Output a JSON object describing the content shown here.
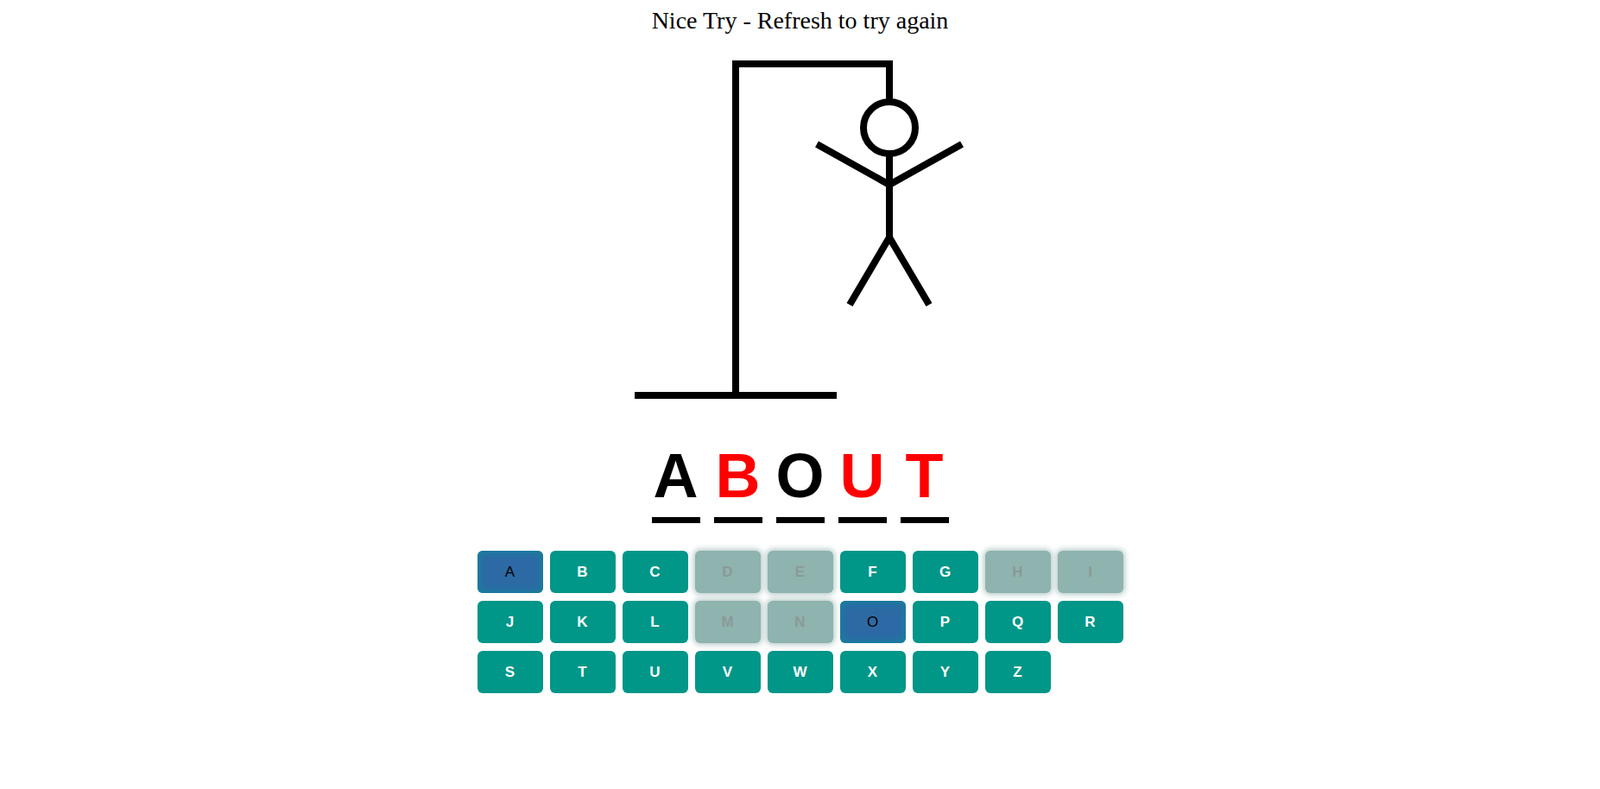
{
  "title": "Nice Try - Refresh to try again",
  "hangman": {
    "parts": 6
  },
  "word": [
    {
      "letter": "A",
      "guessed": true
    },
    {
      "letter": "B",
      "guessed": false
    },
    {
      "letter": "O",
      "guessed": true
    },
    {
      "letter": "U",
      "guessed": false
    },
    {
      "letter": "T",
      "guessed": false
    }
  ],
  "keys": [
    {
      "label": "A",
      "status": "correct"
    },
    {
      "label": "B",
      "status": "unused"
    },
    {
      "label": "C",
      "status": "unused"
    },
    {
      "label": "D",
      "status": "wrong"
    },
    {
      "label": "E",
      "status": "wrong"
    },
    {
      "label": "F",
      "status": "unused"
    },
    {
      "label": "G",
      "status": "unused"
    },
    {
      "label": "H",
      "status": "wrong"
    },
    {
      "label": "I",
      "status": "wrong"
    },
    {
      "label": "J",
      "status": "unused"
    },
    {
      "label": "K",
      "status": "unused"
    },
    {
      "label": "L",
      "status": "unused"
    },
    {
      "label": "M",
      "status": "wrong"
    },
    {
      "label": "N",
      "status": "wrong"
    },
    {
      "label": "O",
      "status": "correct"
    },
    {
      "label": "P",
      "status": "unused"
    },
    {
      "label": "Q",
      "status": "unused"
    },
    {
      "label": "R",
      "status": "unused"
    },
    {
      "label": "S",
      "status": "unused"
    },
    {
      "label": "T",
      "status": "unused"
    },
    {
      "label": "U",
      "status": "unused"
    },
    {
      "label": "V",
      "status": "unused"
    },
    {
      "label": "W",
      "status": "unused"
    },
    {
      "label": "X",
      "status": "unused"
    },
    {
      "label": "Y",
      "status": "unused"
    },
    {
      "label": "Z",
      "status": "unused"
    }
  ]
}
